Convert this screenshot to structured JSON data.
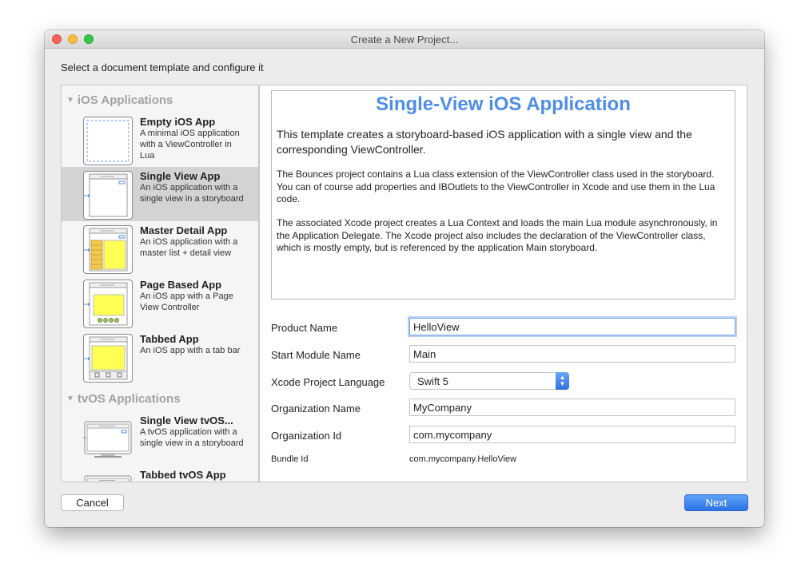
{
  "window": {
    "title": "Create a New Project..."
  },
  "instructions": "Select a document template and configure it",
  "sidebar": {
    "sections": [
      {
        "title": "iOS Applications"
      },
      {
        "title": "tvOS Applications"
      }
    ],
    "templates": [
      {
        "name": "Empty iOS App",
        "description": "A minimal iOS application with a ViewController in Lua"
      },
      {
        "name": "Single View App",
        "description": "An iOS application with a single view in a storyboard",
        "selected": true
      },
      {
        "name": "Master Detail App",
        "description": "An iOS application with a master list + detail view"
      },
      {
        "name": "Page Based App",
        "description": "An iOS app with a Page View Controller"
      },
      {
        "name": "Tabbed App",
        "description": "An iOS app with a tab bar"
      },
      {
        "name": "Single View tvOS...",
        "description": "A tvOS application with a single view in a storyboard"
      },
      {
        "name": "Tabbed tvOS App",
        "description": ""
      }
    ]
  },
  "detail": {
    "title": "Single-View iOS Application",
    "lead": "This template creates a storyboard-based iOS application with a single view and the corresponding ViewController.",
    "para1": "The Bounces project contains a Lua  class extension of the ViewController class used in the storyboard. You can of course add properties and IBOutlets to the ViewController in Xcode and use them in the Lua code.",
    "para2": "The associated Xcode project creates a Lua Context and loads the main Lua module asynchronously, in the Application Delegate. The Xcode project also includes the declaration of the ViewController class, which is mostly empty, but is referenced by the application Main storyboard."
  },
  "form": {
    "product_name": {
      "label": "Product Name",
      "value": "HelloView"
    },
    "start_module": {
      "label": "Start Module Name",
      "value": "Main"
    },
    "language": {
      "label": "Xcode Project Language",
      "value": "Swift 5"
    },
    "org_name": {
      "label": "Organization Name",
      "value": "MyCompany"
    },
    "org_id": {
      "label": "Organization Id",
      "value": "com.mycompany"
    },
    "bundle_id": {
      "label": "Bundle Id",
      "value": "com.mycompany.HelloView"
    }
  },
  "buttons": {
    "cancel": "Cancel",
    "next": "Next"
  },
  "colors": {
    "accent": "#4d8de8",
    "primary_button": "#2a74e4",
    "thumbnail_fill": "#ffff55"
  }
}
